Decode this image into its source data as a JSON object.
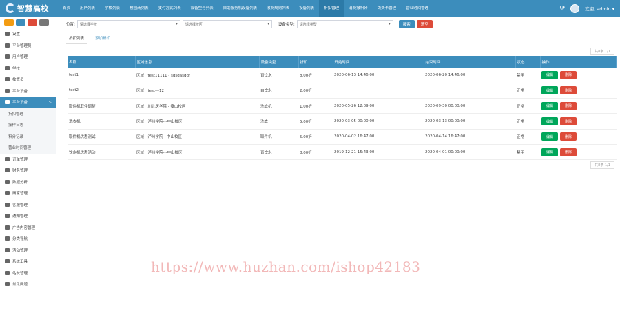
{
  "logo": "智慧高校",
  "nav": [
    "首页",
    "用户列表",
    "学校列表",
    "校园商列表",
    "支付方式列表",
    "设备型号列表",
    "自助服务机设备列表",
    "收费规则列表",
    "设备列表",
    "折扣管理",
    "消费撤积分",
    "免费卡管理",
    "营业时间管理"
  ],
  "user": "欢迎, admin",
  "sidebar": {
    "items": [
      {
        "label": "设置"
      },
      {
        "label": "平台管理员"
      },
      {
        "label": "用户管理"
      },
      {
        "label": "学校"
      },
      {
        "label": "校管员"
      },
      {
        "label": "平台设备"
      },
      {
        "label": "平台设备",
        "caret": "<"
      }
    ],
    "subs": [
      "折扣管理",
      "操作日志",
      "积分记录",
      "营业时间管理"
    ],
    "items2": [
      {
        "label": "订单管理"
      },
      {
        "label": "财务管理"
      },
      {
        "label": "数据分析"
      },
      {
        "label": "商家管理"
      },
      {
        "label": "客服管理"
      },
      {
        "label": "通知管理"
      },
      {
        "label": "广告内容管理"
      },
      {
        "label": "分类导航"
      },
      {
        "label": "活动管理"
      },
      {
        "label": "系统工具"
      },
      {
        "label": "站长管理"
      },
      {
        "label": "常见问题"
      }
    ]
  },
  "filters": {
    "pos_label": "位置:",
    "pos_value": "请选择学校",
    "area_value": "请选择校区",
    "type_label": "设备类型:",
    "type_value": "请选择类型",
    "search": "搜索",
    "reset": "清空"
  },
  "tabs": {
    "list": "折扣列表",
    "add": "添加折扣"
  },
  "pager": {
    "top": "共8条 1/1",
    "bottom": "共8条 1/1"
  },
  "table": {
    "headers": [
      "名称",
      "区域信息",
      "设备类型",
      "折扣",
      "开始时间",
      "结束时间",
      "状态",
      "操作"
    ],
    "rows": [
      [
        "test1",
        "区域：test11111 - sdsdasddf",
        "直饮水",
        "8.00折",
        "2020-06-13 14:46:00",
        "2020-06-20 14:46:00",
        "禁用"
      ],
      [
        "test2",
        "区域：test---12",
        "自饮水",
        "2.00折",
        "",
        "",
        "正常"
      ],
      [
        "取件机取件调整",
        "区域：川北医学院 - 泰山校区",
        "洗衣机",
        "1.00折",
        "2020-05-26 12:09:00",
        "2020-09-30 00:00:00",
        "正常"
      ],
      [
        "洗衣机",
        "区域：泸州学院---中山校区",
        "洗衣",
        "5.00折",
        "2020-03-05 00:00:00",
        "2020-03-13 00:00:00",
        "正常"
      ],
      [
        "取件机优惠测试",
        "区域：泸州学院 - 中山校区",
        "取件机",
        "5.00折",
        "2020-04-02 16:47:00",
        "2020-04-14 16:47:00",
        "正常"
      ],
      [
        "饮水机优惠活动",
        "区域：泸州学院---中山校区",
        "直饮水",
        "8.00折",
        "2019-12-21 15:43:00",
        "2020-04-01 00:00:00",
        "禁用"
      ]
    ],
    "edit": "编辑",
    "delete": "删除"
  },
  "watermark": "https://www.huzhan.com/ishop42183",
  "colors": {
    "primary": "#3c8dbc",
    "danger": "#dd4b39",
    "success": "#00a65a"
  }
}
